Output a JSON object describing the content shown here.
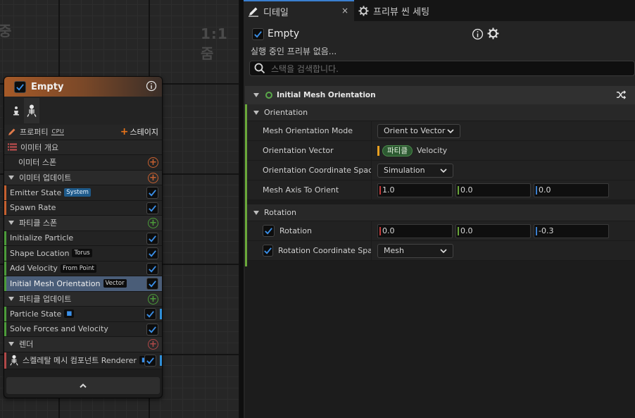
{
  "graph": {
    "label_left": "중",
    "label_right": "1:1 줌"
  },
  "node": {
    "title": "Empty",
    "properties_label": "프로퍼티",
    "cpu_label": "CPU",
    "stage_label": "스테이지",
    "emitter_summary": "이미터 개요",
    "emitter_spawn": "이미터 스폰",
    "emitter_update": "이미터 업데이트",
    "emitter_state": "Emitter State",
    "emitter_state_badge": "System",
    "spawn_rate": "Spawn Rate",
    "particle_spawn": "파티클 스폰",
    "initialize_particle": "Initialize Particle",
    "shape_location": "Shape Location",
    "shape_location_badge": "Torus",
    "add_velocity": "Add Velocity",
    "add_velocity_badge": "From Point",
    "initial_mesh_orientation": "Initial Mesh Orientation",
    "initial_mesh_orientation_badge": "Vector",
    "particle_update": "파티클 업데이트",
    "particle_state": "Particle State",
    "solve_forces": "Solve Forces and Velocity",
    "render": "렌더",
    "renderer": "스켈레탈 메시 컴포넌트 Renderer"
  },
  "tabs": {
    "details": "디테일",
    "close": "×",
    "preview": "프리뷰 씬 세팅"
  },
  "panel": {
    "title": "Empty",
    "subtitle": "실행 중인 프리뷰 없음...",
    "search_placeholder": "스택을 검색합니다."
  },
  "category": {
    "title": "Initial Mesh Orientation"
  },
  "orientation": {
    "group": "Orientation",
    "mode_label": "Mesh Orientation Mode",
    "mode_value": "Orient to Vector",
    "vector_label": "Orientation Vector",
    "vector_pill": "파티클",
    "vector_value": "Velocity",
    "space_label": "Orientation Coordinate Space",
    "space_value": "Simulation",
    "axis_label": "Mesh Axis To Orient",
    "axis_x": "1.0",
    "axis_y": "0.0",
    "axis_z": "0.0"
  },
  "rotation": {
    "group": "Rotation",
    "rotation_label": "Rotation",
    "rot_x": "0.0",
    "rot_y": "0.0",
    "rot_z": "-0.3",
    "space_label": "Rotation Coordinate Spac",
    "space_value": "Mesh"
  },
  "colors": {
    "accent": "#3a7fd0",
    "selected_row": "#4a5d78",
    "node_header": "#a65a28",
    "emitter_stripe": "#c66030",
    "spawn_stripe": "#4c9c3a",
    "render_stripe": "#b04848"
  }
}
